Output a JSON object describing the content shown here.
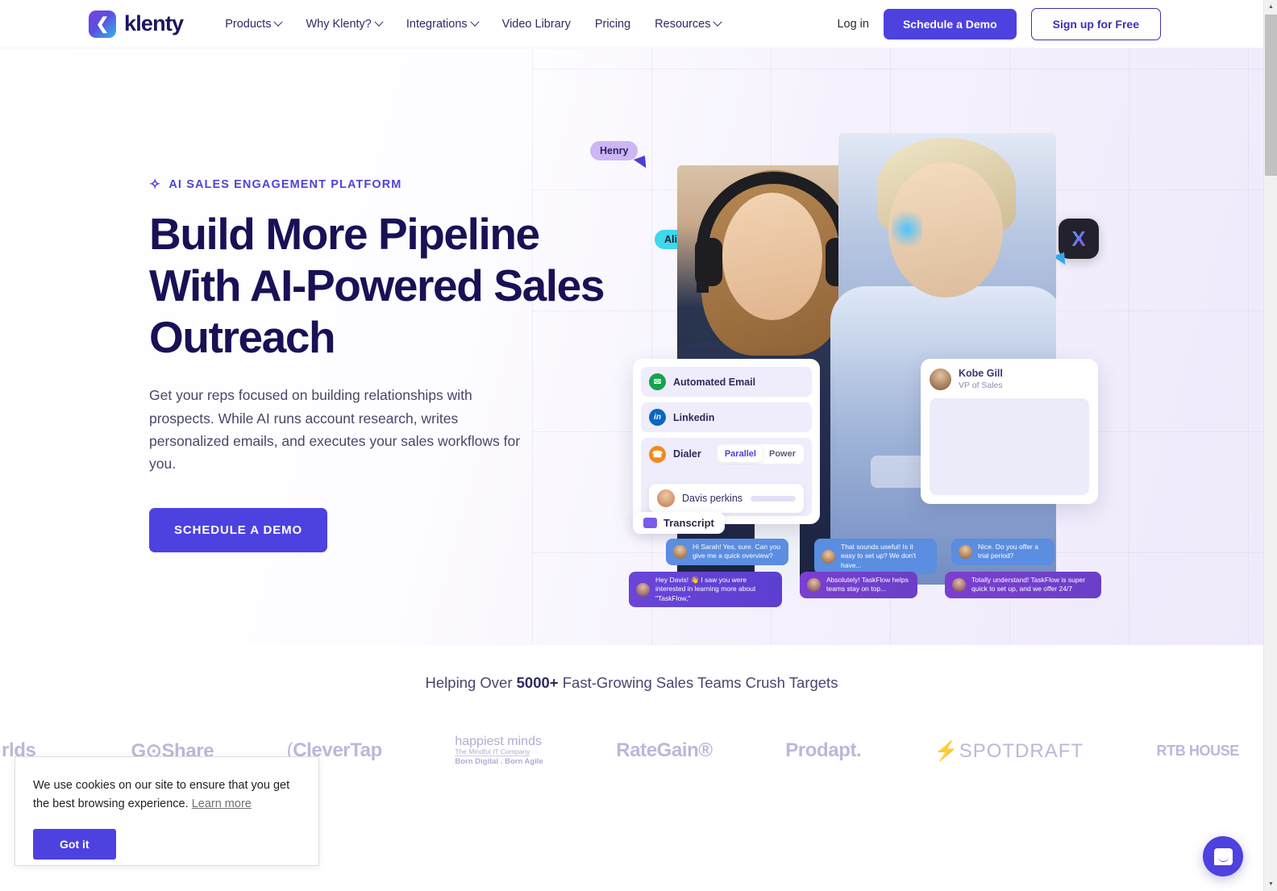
{
  "header": {
    "logo_text": "klenty",
    "logo_icon": "klenty-chevron-logo",
    "nav": [
      {
        "label": "Products",
        "has_dropdown": true
      },
      {
        "label": "Why Klenty?",
        "has_dropdown": true
      },
      {
        "label": "Integrations",
        "has_dropdown": true
      },
      {
        "label": "Video Library",
        "has_dropdown": false
      },
      {
        "label": "Pricing",
        "has_dropdown": false
      },
      {
        "label": "Resources",
        "has_dropdown": true
      }
    ],
    "login_label": "Log in",
    "demo_button": "Schedule a Demo",
    "signup_button": "Sign up for Free"
  },
  "hero": {
    "eyebrow": "AI SALES ENGAGEMENT PLATFORM",
    "eyebrow_icon": "sparkle-icon",
    "title_line1": "Build More Pipeline",
    "title_line2": "With AI-Powered Sales",
    "title_line3": "Outreach",
    "subtitle": "Get your reps focused on building relationships with prospects. While AI runs account research, writes personalized emails, and executes your sales workflows for you.",
    "cta": "SCHEDULE A DEMO",
    "accent_color": "#4d41e0",
    "title_color": "#191156"
  },
  "hero_art": {
    "tags": [
      {
        "name": "Henry",
        "color": "#cdb6f5"
      },
      {
        "name": "Alina",
        "color": "#3fd8ec"
      }
    ],
    "x_badge": "X",
    "channels_card": {
      "rows": [
        {
          "label": "Automated Email",
          "icon": "mail-icon",
          "color": "#15a34a"
        },
        {
          "label": "Linkedin",
          "icon": "linkedin-icon",
          "color": "#0a66c2"
        },
        {
          "label": "Dialer",
          "icon": "phone-icon",
          "color": "#f08a1c"
        }
      ],
      "dialer_modes": [
        {
          "label": "Parallel",
          "active": true
        },
        {
          "label": "Power",
          "active": false
        }
      ],
      "contact": "Davis perkins"
    },
    "profile_card": {
      "name": "Kobe Gill",
      "role": "VP of Sales"
    },
    "transcript": {
      "label": "Transcript",
      "icon": "transcript-icon",
      "messages": [
        {
          "speaker": "prospect",
          "text": "Hi Sarah! Yes, sure. Can you give me a quick overview?"
        },
        {
          "speaker": "prospect",
          "text": "That sounds useful! Is it easy to set up? We don't have..."
        },
        {
          "speaker": "prospect",
          "text": "Nice. Do you offer a trial period?"
        },
        {
          "speaker": "rep",
          "text": "Hey Davis! 👋 I saw you were interested in learning more about \"TaskFlow,\""
        },
        {
          "speaker": "rep",
          "text": "Absolutely! TaskFlow helps teams stay on top..."
        },
        {
          "speaker": "rep",
          "text": "Totally understand! TaskFlow is super quick to set up, and we offer 24/7"
        }
      ]
    }
  },
  "logos": {
    "title_prefix": "Helping Over ",
    "title_count": "5000+",
    "title_suffix": " Fast-Growing Sales Teams Crush Targets",
    "items": [
      {
        "name": "rlds"
      },
      {
        "name": "G⊙Share"
      },
      {
        "name": "CleverTap"
      },
      {
        "name": "happiest minds"
      },
      {
        "name": "RateGain®"
      },
      {
        "name": "Prodapt."
      },
      {
        "name": "SPOTDRAFT"
      },
      {
        "name": "RTB HOUSE"
      }
    ],
    "happiest_minds": {
      "line1": "happiest minds",
      "line2": "The Mindful IT Company",
      "line3": "Born Digital . Born Agile"
    }
  },
  "cookie_banner": {
    "text": "We use cookies on our site to ensure that you get the best browsing experience.",
    "link": "Learn more",
    "button": "Got it"
  },
  "chat_widget": {
    "icon": "intercom-chat-icon",
    "color": "#4d41e0"
  },
  "scrollbar": {
    "up_arrow": "▲",
    "down_arrow": "▼"
  }
}
